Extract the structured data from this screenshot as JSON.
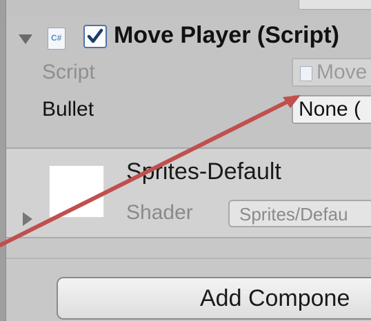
{
  "component": {
    "title": "Move Player (Script)",
    "enabled": true,
    "icon": "csharp-script-icon",
    "icon_text": "C#",
    "properties": {
      "script_label": "Script",
      "script_value": "Move",
      "bullet_label": "Bullet",
      "bullet_value": "None ("
    }
  },
  "material": {
    "name": "Sprites-Default",
    "shader_label": "Shader",
    "shader_value": "Sprites/Defau"
  },
  "footer": {
    "add_component_label": "Add Compone"
  },
  "colors": {
    "annotation_arrow": "#c0504d",
    "checkbox_border": "#4b73a8"
  }
}
